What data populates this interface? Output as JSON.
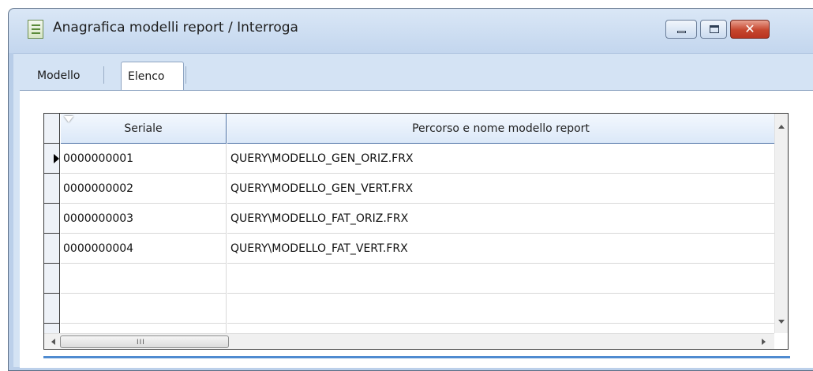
{
  "window": {
    "title": "Anagrafica modelli report / Interroga",
    "close_glyph": "✕"
  },
  "tabs": [
    {
      "label": "Modello",
      "active": false
    },
    {
      "label": "Elenco",
      "active": true
    }
  ],
  "grid": {
    "columns": [
      "Seriale",
      "Percorso e nome modello report"
    ],
    "rows": [
      {
        "seriale": "0000000001",
        "percorso": "QUERY\\MODELLO_GEN_ORIZ.FRX"
      },
      {
        "seriale": "0000000002",
        "percorso": "QUERY\\MODELLO_GEN_VERT.FRX"
      },
      {
        "seriale": "0000000003",
        "percorso": "QUERY\\MODELLO_FAT_ORIZ.FRX"
      },
      {
        "seriale": "0000000004",
        "percorso": "QUERY\\MODELLO_FAT_VERT.FRX"
      }
    ],
    "current_row": 0,
    "scroll_grip": "III"
  },
  "colors": {
    "accent": "#4f8bd0",
    "close_button": "#c6462e",
    "tab_background": "#d4e3f4"
  },
  "icons": [
    "app-icon",
    "minimize-icon",
    "maximize-icon",
    "close-icon",
    "row-pointer-icon"
  ]
}
